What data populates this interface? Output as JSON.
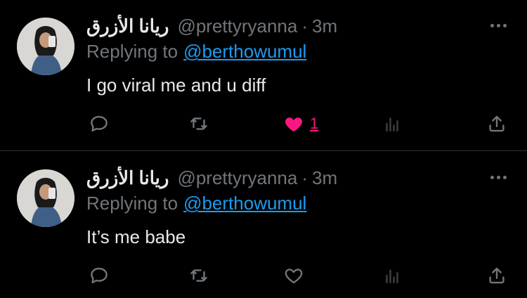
{
  "tweets": [
    {
      "display_name": "ريانا الأزرق",
      "handle": "@prettyryanna",
      "separator": "·",
      "time": "3m",
      "replying_prefix": "Replying to",
      "replying_to": "@berthowumul",
      "text": "I go viral me and u diff",
      "like_count": "1",
      "liked": true
    },
    {
      "display_name": "ريانا الأزرق",
      "handle": "@prettyryanna",
      "separator": "·",
      "time": "3m",
      "replying_prefix": "Replying to",
      "replying_to": "@berthowumul",
      "text": "It’s me babe",
      "like_count": "",
      "liked": false
    }
  ],
  "icons": {
    "more": "more-dots-icon",
    "reply": "reply-bubble-icon",
    "retweet": "retweet-icon",
    "like": "heart-icon",
    "views": "analytics-bars-icon",
    "share": "share-upload-icon"
  },
  "colors": {
    "background": "#000000",
    "text": "#e7e9ea",
    "secondary": "#71767b",
    "link": "#1d9bf0",
    "like": "#f91880",
    "divider": "#2f3336"
  }
}
